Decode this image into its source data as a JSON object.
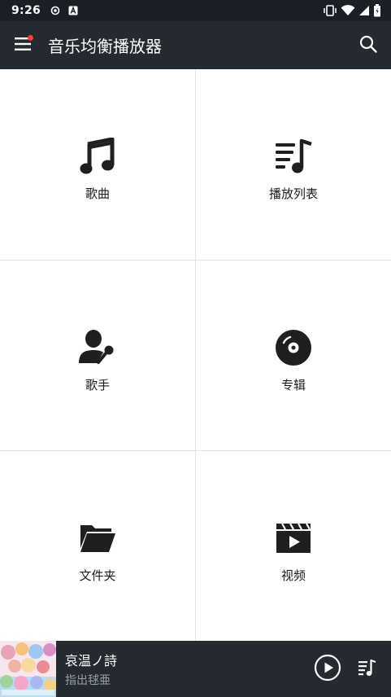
{
  "status_bar": {
    "time": "9:26",
    "icons": [
      "target-icon",
      "a-box-icon",
      "vibrate-icon",
      "wifi-icon",
      "signal-icon",
      "battery-icon"
    ]
  },
  "app_bar": {
    "title": "音乐均衡播放器",
    "menu_icon": "hamburger-menu-icon",
    "search_icon": "search-icon",
    "notification_dot_color": "#ff3b30"
  },
  "library": {
    "tiles": [
      {
        "label": "歌曲",
        "icon": "music-note-icon"
      },
      {
        "label": "播放列表",
        "icon": "playlist-icon"
      },
      {
        "label": "歌手",
        "icon": "singer-icon"
      },
      {
        "label": "专辑",
        "icon": "album-disc-icon"
      },
      {
        "label": "文件夹",
        "icon": "folder-icon"
      },
      {
        "label": "视频",
        "icon": "video-icon"
      }
    ]
  },
  "now_playing": {
    "title": "哀温ノ詩",
    "artist": "指出毬亜",
    "play_icon": "play-icon",
    "queue_icon": "queue-icon"
  },
  "colors": {
    "status_bar": "#1b1f25",
    "app_bar": "#252a31",
    "icon_dark": "#1f1f1f",
    "divider": "#e3e3e3"
  }
}
